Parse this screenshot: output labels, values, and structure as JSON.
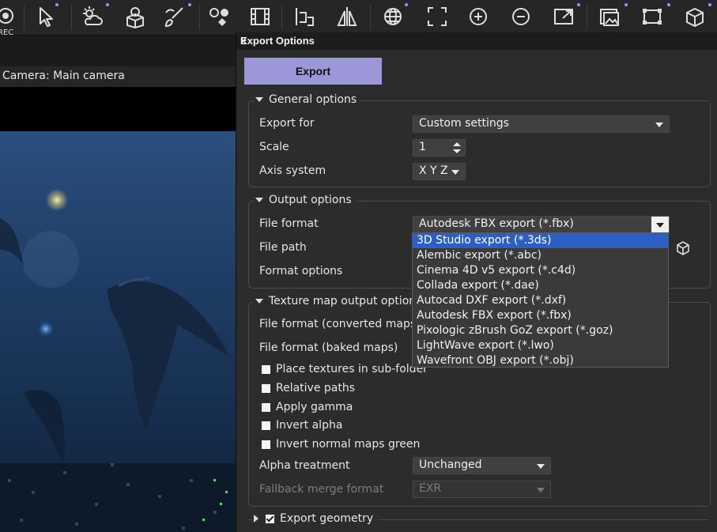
{
  "toolbar": {
    "rec_label": "REC",
    "icons": [
      "record-icon",
      "pointer-icon",
      "sun-cloud-icon",
      "gear-box-icon",
      "paint-icon",
      "toggle-shapes-icon",
      "film-icon",
      "align-icon",
      "mirror-icon",
      "globe-icon",
      "frame-icon",
      "zoom-in-icon",
      "zoom-out-icon",
      "maximize-icon",
      "gallery-icon",
      "crop-icon",
      "render-icon"
    ]
  },
  "viewport": {
    "camera_label": "Camera: Main camera"
  },
  "dialog": {
    "title": "Export Options",
    "close_glyph": "×",
    "export_button": "Export",
    "general": {
      "title": "General options",
      "export_for_label": "Export for",
      "export_for_value": "Custom settings",
      "scale_label": "Scale",
      "scale_value": "1",
      "axis_label": "Axis system",
      "axis_value": "X Y Z"
    },
    "output": {
      "title": "Output options",
      "file_format_label": "File format",
      "file_format_value": "Autodesk FBX export (*.fbx)",
      "file_path_label": "File path",
      "format_options_label": "Format options"
    },
    "texture": {
      "title": "Texture map output option",
      "converted_label": "File format (converted maps",
      "baked_label": "File format (baked maps)",
      "checkboxes": [
        {
          "label": "Place textures in sub-folder",
          "checked": false
        },
        {
          "label": "Relative paths",
          "checked": false
        },
        {
          "label": "Apply gamma",
          "checked": false
        },
        {
          "label": "Invert alpha",
          "checked": false
        },
        {
          "label": "Invert normal maps green",
          "checked": false
        }
      ],
      "alpha_label": "Alpha treatment",
      "alpha_value": "Unchanged",
      "fallback_label": "Fallback merge format",
      "fallback_value": "EXR"
    },
    "geometry": {
      "title": "Export geometry",
      "checked": true
    },
    "dropdown": {
      "items": [
        "3D Studio export (*.3ds)",
        "Alembic export (*.abc)",
        "Cinema 4D v5 export (*.c4d)",
        "Collada export (*.dae)",
        "Autocad DXF export (*.dxf)",
        "Autodesk FBX export (*.fbx)",
        "Pixologic zBrush GoZ export (*.goz)",
        "LightWave export (*.lwo)",
        "Wavefront OBJ export (*.obj)"
      ],
      "selected": "3D Studio export (*.3ds)"
    }
  },
  "colors": {
    "accent_button": "#9c97d6",
    "selection": "#2b5fc1",
    "panel": "#2c2c2c"
  }
}
